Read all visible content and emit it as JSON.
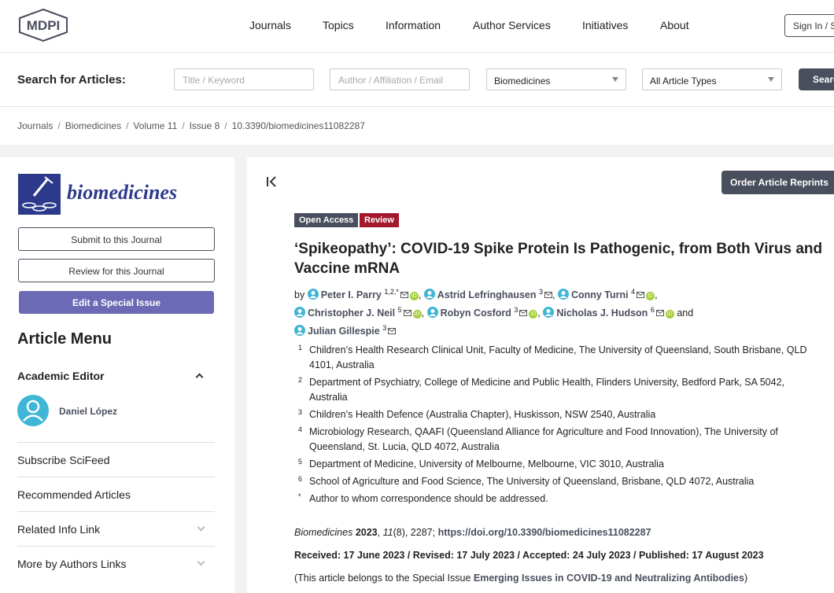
{
  "header": {
    "logo_text": "MDPI",
    "nav": [
      "Journals",
      "Topics",
      "Information",
      "Author Services",
      "Initiatives",
      "About"
    ],
    "signin_label": "Sign In / Sign Up"
  },
  "search": {
    "label": "Search for Articles:",
    "title_placeholder": "Title / Keyword",
    "author_placeholder": "Author / Affiliation / Email",
    "journal_value": "Biomedicines",
    "type_value": "All Article Types",
    "button_label": "Search"
  },
  "breadcrumb": [
    "Journals",
    "Biomedicines",
    "Volume 11",
    "Issue 8",
    "10.3390/biomedicines11082287"
  ],
  "sidebar": {
    "journal_name": "biomedicines",
    "submit_label": "Submit to this Journal",
    "review_label": "Review for this Journal",
    "special_issue_label": "Edit a Special Issue",
    "menu_title": "Article Menu",
    "academic_editor_label": "Academic Editor",
    "editor_name": "Daniel López",
    "items": [
      "Subscribe SciFeed",
      "Recommended Articles",
      "Related Info Link",
      "More by Authors Links"
    ]
  },
  "article": {
    "reprint_label": "Order Article Reprints",
    "badge_open": "Open Access",
    "badge_type": "Review",
    "title": "‘Spikeopathy’: COVID-19 Spike Protein Is Pathogenic, from Both Virus and Vaccine mRNA",
    "by": "by",
    "and": "and",
    "authors": [
      {
        "name": "Peter I. Parry",
        "sup": "1,2,*"
      },
      {
        "name": "Astrid Lefringhausen",
        "sup": "3"
      },
      {
        "name": "Conny Turni",
        "sup": "4"
      },
      {
        "name": "Christopher J. Neil",
        "sup": "5"
      },
      {
        "name": "Robyn Cosford",
        "sup": "3"
      },
      {
        "name": "Nicholas J. Hudson",
        "sup": "6"
      },
      {
        "name": "Julian Gillespie",
        "sup": "3"
      }
    ],
    "affiliations": [
      {
        "num": "1",
        "text": "Children’s Health Research Clinical Unit, Faculty of Medicine, The University of Queensland, South Brisbane, QLD 4101, Australia"
      },
      {
        "num": "2",
        "text": "Department of Psychiatry, College of Medicine and Public Health, Flinders University, Bedford Park, SA 5042, Australia"
      },
      {
        "num": "3",
        "text": "Children’s Health Defence (Australia Chapter), Huskisson, NSW 2540, Australia"
      },
      {
        "num": "4",
        "text": "Microbiology Research, QAAFI (Queensland Alliance for Agriculture and Food Innovation), The University of Queensland, St. Lucia, QLD 4072, Australia"
      },
      {
        "num": "5",
        "text": "Department of Medicine, University of Melbourne, Melbourne, VIC 3010, Australia"
      },
      {
        "num": "6",
        "text": "School of Agriculture and Food Science, The University of Queensland, Brisbane, QLD 4072, Australia"
      },
      {
        "num": "*",
        "text": "Author to whom correspondence should be addressed."
      }
    ],
    "citation": {
      "journal": "Biomedicines",
      "year": "2023",
      "volume": "11",
      "issue_pages": "(8), 2287;",
      "doi": "https://doi.org/10.3390/biomedicines11082287"
    },
    "dates": "Received: 17 June 2023 / Revised: 17 July 2023 / Accepted: 24 July 2023 / Published: 17 August 2023",
    "special_issue_prefix": "(This article belongs to the Special Issue",
    "special_issue_name": "Emerging Issues in COVID-19 and Neutralizing Antibodies",
    "special_issue_suffix": ")"
  },
  "colors": {
    "brand_dark": "#4a4f5e",
    "special_issue_button": "#6c6ab5",
    "open_access_badge": "#4a4f5e",
    "review_badge": "#a3182e",
    "journal_name": "#2d3a8c",
    "orcid": "#a6ce39",
    "avatar": "#3fb6d6"
  }
}
